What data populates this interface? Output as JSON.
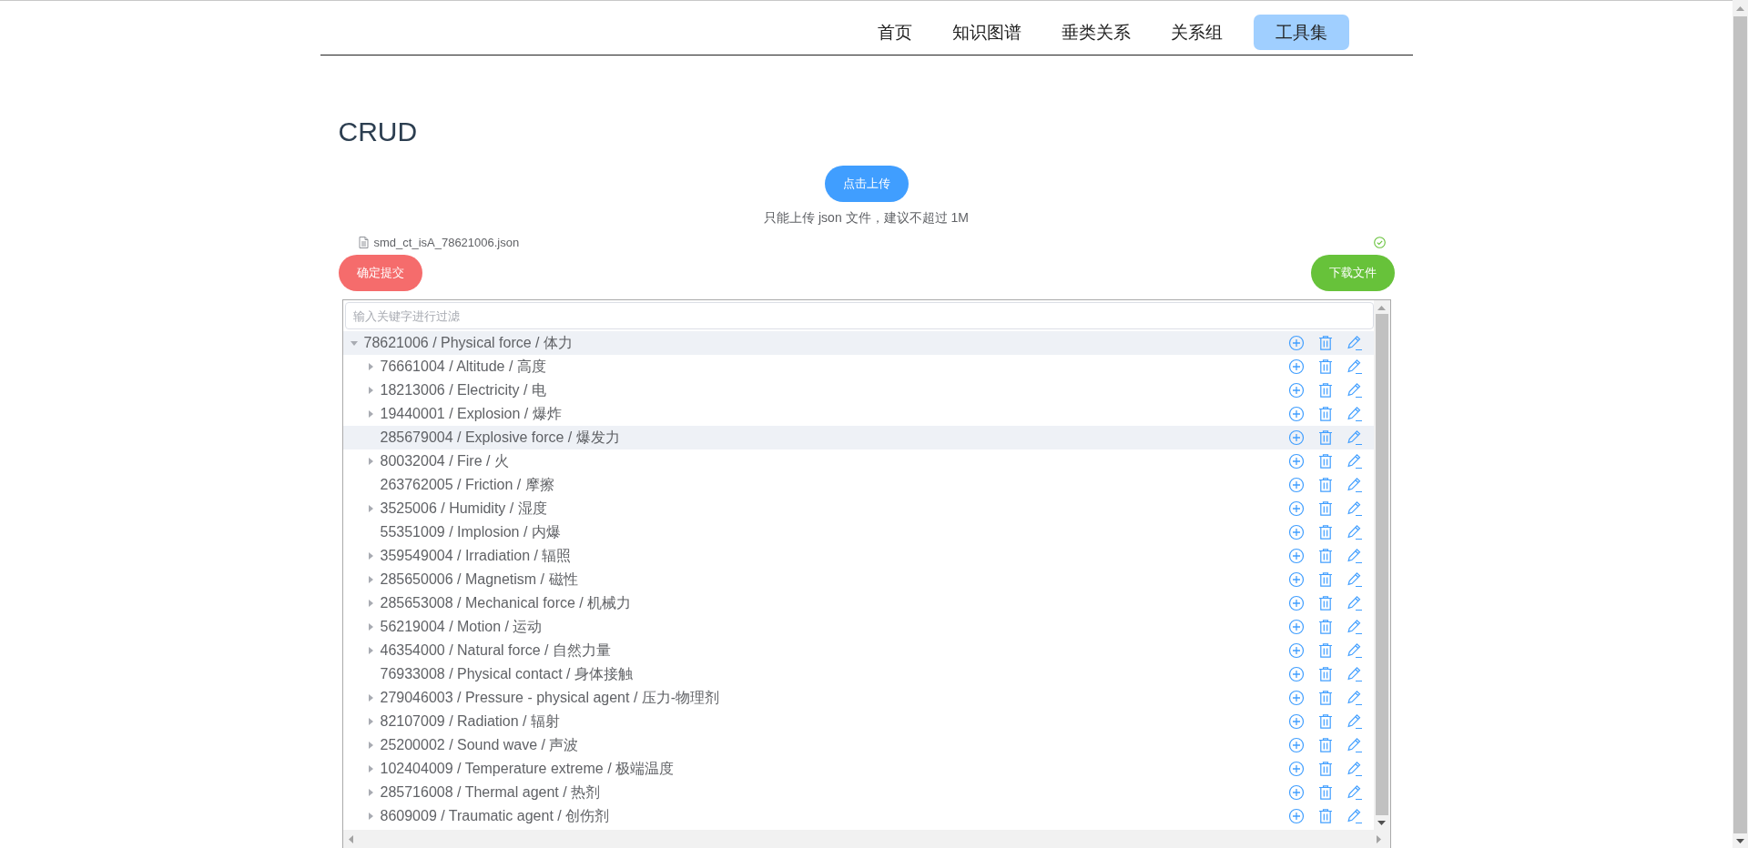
{
  "nav": [
    {
      "label": "首页",
      "selected": false
    },
    {
      "label": "知识图谱",
      "selected": false
    },
    {
      "label": "垂类关系",
      "selected": false
    },
    {
      "label": "关系组",
      "selected": false
    },
    {
      "label": "工具集",
      "selected": true
    }
  ],
  "title": "CRUD",
  "upload": {
    "button": "点击上传",
    "hint": "只能上传 json 文件，建议不超过 1M"
  },
  "file": {
    "name": "smd_ct_isA_78621006.json",
    "uploaded": true
  },
  "submit_button": "确定提交",
  "download_button": "下载文件",
  "tree": {
    "placeholder": "输入关键字进行过滤",
    "nodes": [
      {
        "label": "78621006 / Physical force / 体力",
        "expandable": true,
        "expanded": true,
        "highlighted": true,
        "children": [
          {
            "label": "76661004 / Altitude / 高度",
            "expandable": true,
            "highlighted": false
          },
          {
            "label": "18213006 / Electricity / 电",
            "expandable": true,
            "highlighted": false
          },
          {
            "label": "19440001 / Explosion / 爆炸",
            "expandable": true,
            "highlighted": false
          },
          {
            "label": "285679004 / Explosive force / 爆发力",
            "expandable": false,
            "highlighted": true
          },
          {
            "label": "80032004 / Fire / 火",
            "expandable": true,
            "highlighted": false
          },
          {
            "label": "263762005 / Friction / 摩擦",
            "expandable": false,
            "highlighted": false
          },
          {
            "label": "3525006 / Humidity / 湿度",
            "expandable": true,
            "highlighted": false
          },
          {
            "label": "55351009 / Implosion / 内爆",
            "expandable": false,
            "highlighted": false
          },
          {
            "label": "359549004 / Irradiation / 辐照",
            "expandable": true,
            "highlighted": false
          },
          {
            "label": "285650006 / Magnetism / 磁性",
            "expandable": true,
            "highlighted": false
          },
          {
            "label": "285653008 / Mechanical force / 机械力",
            "expandable": true,
            "highlighted": false
          },
          {
            "label": "56219004 / Motion / 运动",
            "expandable": true,
            "highlighted": false
          },
          {
            "label": "46354000 / Natural force / 自然力量",
            "expandable": true,
            "highlighted": false
          },
          {
            "label": "76933008 / Physical contact / 身体接触",
            "expandable": false,
            "highlighted": false
          },
          {
            "label": "279046003 / Pressure - physical agent / 压力-物理剂",
            "expandable": true,
            "highlighted": false
          },
          {
            "label": "82107009 / Radiation / 辐射",
            "expandable": true,
            "highlighted": false
          },
          {
            "label": "25200002 / Sound wave / 声波",
            "expandable": true,
            "highlighted": false
          },
          {
            "label": "102404009 / Temperature extreme / 极端温度",
            "expandable": true,
            "highlighted": false
          },
          {
            "label": "285716008 / Thermal agent / 热剂",
            "expandable": true,
            "highlighted": false
          },
          {
            "label": "8609009 / Traumatic agent / 创伤剂",
            "expandable": true,
            "highlighted": false
          }
        ]
      }
    ]
  }
}
